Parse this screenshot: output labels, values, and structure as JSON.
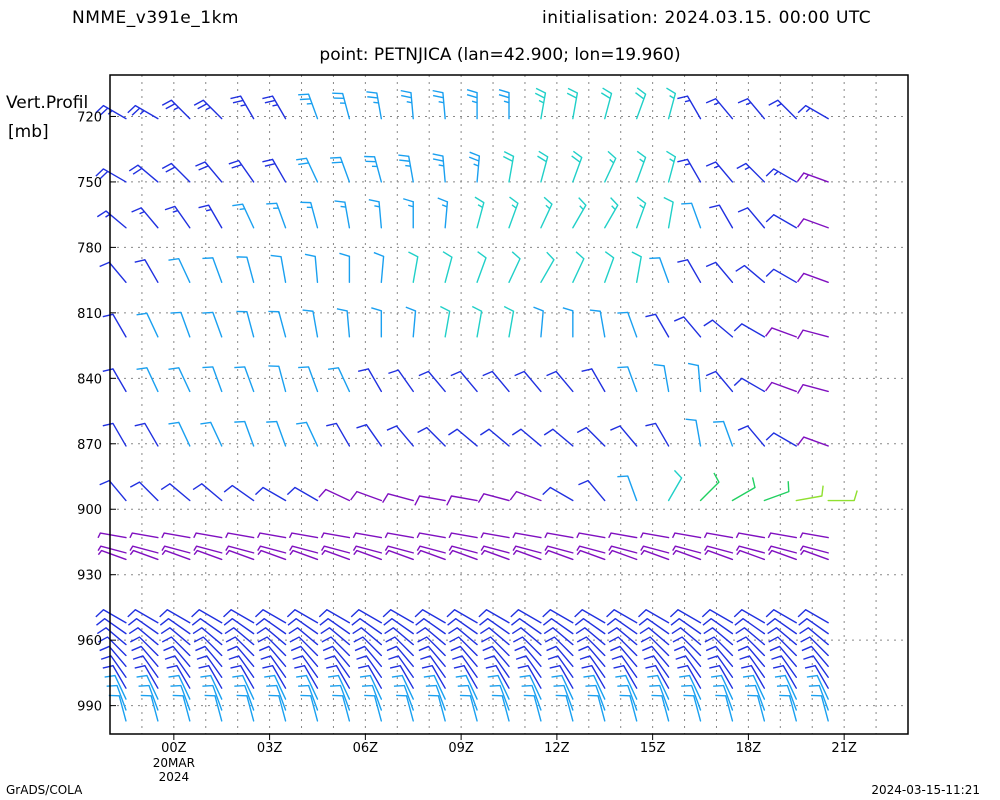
{
  "header": {
    "model": "NMME_v391e_1km",
    "initialisation": "initialisation: 2024.03.15. 00:00 UTC",
    "point": "point: PETNJICA (lan=42.900; lon=19.960)"
  },
  "footer": {
    "left": "GrADS/COLA",
    "right": "2024-03-15-11:21"
  },
  "chart_data": {
    "type": "wind-barbs",
    "ylabel_line1": "Vert.Profil",
    "ylabel_line2": "[mb]",
    "y_ticks": [
      720,
      750,
      780,
      810,
      840,
      870,
      900,
      930,
      960,
      990
    ],
    "ylim": [
      1003,
      701
    ],
    "x_ticks": [
      {
        "hour": 0,
        "label": "00Z",
        "sub": [
          "20MAR",
          "2024"
        ]
      },
      {
        "hour": 3,
        "label": "03Z"
      },
      {
        "hour": 6,
        "label": "06Z"
      },
      {
        "hour": 9,
        "label": "09Z"
      },
      {
        "hour": 12,
        "label": "12Z"
      },
      {
        "hour": 15,
        "label": "15Z"
      },
      {
        "hour": 18,
        "label": "18Z"
      },
      {
        "hour": 21,
        "label": "21Z"
      }
    ],
    "xlim_hours": [
      -2,
      23
    ],
    "grid": "dotted",
    "profile_times_hours": [
      -1.5,
      -0.5,
      0.5,
      1.5,
      2.5,
      3.5,
      4.5,
      5.5,
      6.5,
      7.5,
      8.5,
      9.5,
      10.5,
      11.5,
      12.5,
      13.5,
      14.5,
      15.5,
      16.5,
      17.5,
      18.5,
      19.5,
      20.5,
      21.5,
      22.5
    ],
    "barb_levels_mb": [
      721,
      750,
      771,
      796,
      821,
      846,
      871,
      896
    ],
    "barb_dirs_deg": [
      [
        300,
        300,
        315,
        315,
        330,
        330,
        340,
        345,
        350,
        355,
        355,
        0,
        0,
        10,
        10,
        15,
        20,
        15,
        330,
        320,
        320,
        315,
        300
      ],
      [
        300,
        310,
        315,
        320,
        325,
        330,
        335,
        340,
        345,
        350,
        355,
        5,
        10,
        15,
        20,
        25,
        20,
        15,
        330,
        320,
        315,
        300,
        290
      ],
      [
        310,
        320,
        325,
        330,
        335,
        340,
        345,
        350,
        355,
        0,
        5,
        15,
        20,
        25,
        30,
        30,
        20,
        10,
        340,
        330,
        320,
        300,
        290
      ],
      [
        320,
        330,
        335,
        340,
        345,
        350,
        355,
        0,
        5,
        10,
        15,
        20,
        25,
        30,
        25,
        20,
        10,
        340,
        330,
        320,
        310,
        300,
        290
      ],
      [
        330,
        335,
        340,
        340,
        345,
        345,
        350,
        355,
        0,
        5,
        10,
        10,
        10,
        5,
        0,
        350,
        340,
        330,
        320,
        310,
        300,
        290,
        285
      ],
      [
        330,
        335,
        335,
        340,
        340,
        345,
        340,
        335,
        330,
        325,
        320,
        320,
        320,
        320,
        320,
        330,
        340,
        350,
        355,
        320,
        300,
        290,
        285
      ],
      [
        330,
        330,
        335,
        335,
        340,
        340,
        335,
        330,
        325,
        320,
        315,
        310,
        310,
        310,
        310,
        315,
        320,
        330,
        350,
        340,
        320,
        300,
        290
      ],
      [
        320,
        315,
        310,
        310,
        305,
        300,
        300,
        295,
        290,
        285,
        280,
        280,
        285,
        290,
        300,
        320,
        340,
        30,
        45,
        60,
        70,
        80,
        90
      ]
    ],
    "barb_speeds_kt": [
      [
        25,
        25,
        25,
        25,
        25,
        25,
        25,
        25,
        25,
        25,
        25,
        25,
        25,
        25,
        20,
        20,
        20,
        15,
        15,
        15,
        15,
        15,
        15
      ],
      [
        20,
        20,
        20,
        20,
        20,
        20,
        20,
        20,
        25,
        25,
        25,
        25,
        20,
        20,
        20,
        15,
        15,
        15,
        15,
        15,
        15,
        15,
        15
      ],
      [
        15,
        15,
        15,
        15,
        15,
        15,
        15,
        15,
        15,
        15,
        15,
        15,
        15,
        15,
        15,
        15,
        15,
        10,
        10,
        10,
        10,
        10,
        10
      ],
      [
        10,
        10,
        10,
        10,
        10,
        10,
        10,
        10,
        10,
        10,
        10,
        10,
        10,
        10,
        10,
        10,
        10,
        10,
        10,
        10,
        10,
        10,
        10
      ],
      [
        10,
        10,
        10,
        10,
        10,
        10,
        10,
        10,
        10,
        10,
        10,
        10,
        10,
        10,
        10,
        10,
        10,
        10,
        10,
        10,
        10,
        10,
        10
      ],
      [
        10,
        10,
        10,
        10,
        10,
        10,
        10,
        10,
        10,
        10,
        10,
        10,
        10,
        10,
        10,
        10,
        10,
        10,
        10,
        10,
        10,
        10,
        10
      ],
      [
        10,
        10,
        10,
        10,
        10,
        10,
        10,
        10,
        10,
        10,
        10,
        10,
        10,
        10,
        10,
        10,
        10,
        10,
        10,
        10,
        10,
        10,
        10
      ],
      [
        10,
        10,
        10,
        10,
        10,
        10,
        10,
        10,
        10,
        10,
        10,
        10,
        10,
        10,
        10,
        10,
        10,
        10,
        10,
        10,
        10,
        10,
        10
      ]
    ],
    "low_levels_mb": [
      913,
      920,
      923,
      952,
      957,
      962,
      967,
      972,
      977,
      982,
      987,
      992,
      997
    ],
    "low_dirs_deg": [
      280,
      285,
      290,
      300,
      305,
      310,
      315,
      320,
      325,
      330,
      335,
      340,
      345
    ],
    "low_speeds_kt": [
      5,
      5,
      5,
      10,
      10,
      10,
      10,
      10,
      10,
      10,
      10,
      10,
      10
    ],
    "palette": [
      "#2030e0",
      "#1aa0f0",
      "#20d0c8",
      "#20d060",
      "#90e030",
      "#e0d830",
      "#f0a020",
      "#e05020",
      "#e02040",
      "#c020c0",
      "#8010c0"
    ]
  }
}
